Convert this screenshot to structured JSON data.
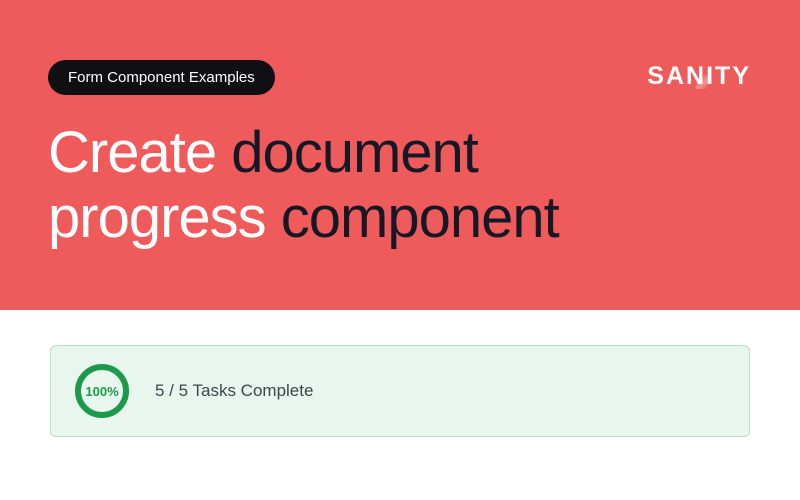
{
  "badge": {
    "label": "Form Component Examples"
  },
  "brand": {
    "name": "SANITY"
  },
  "title": {
    "segments": [
      {
        "text": "Create ",
        "tone": "white"
      },
      {
        "text": "document",
        "tone": "dark"
      },
      {
        "text": "progress ",
        "tone": "white"
      },
      {
        "text": "component",
        "tone": "dark"
      }
    ]
  },
  "progress": {
    "percent_label": "100%",
    "percent_value": 100,
    "status_text": "5 / 5 Tasks Complete",
    "ring_color": "#1a9a4a",
    "card_bg": "#e8f6ed",
    "card_border": "#b7e3c4"
  }
}
